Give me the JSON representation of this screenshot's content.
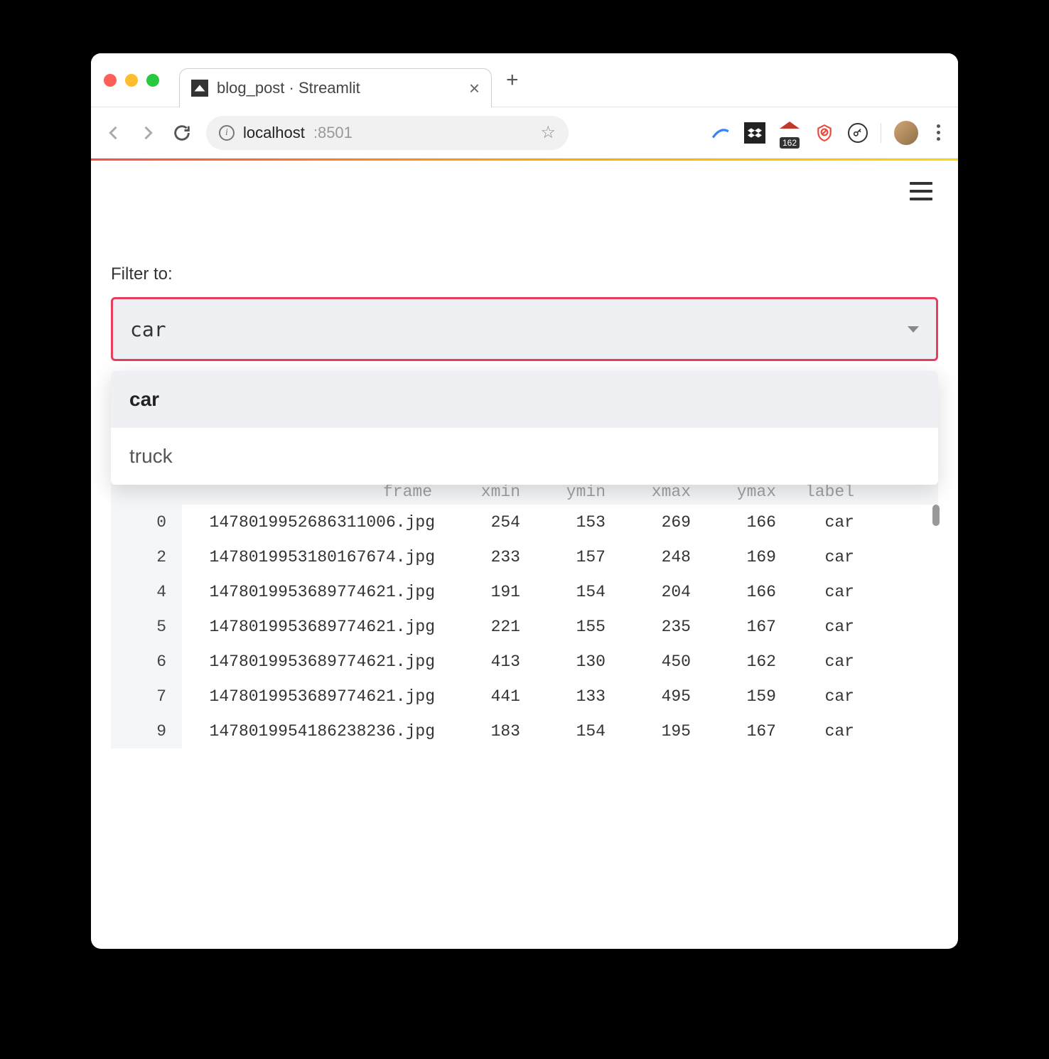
{
  "browser": {
    "tab_title": "blog_post · Streamlit",
    "address_host": "localhost",
    "address_port": ":8501",
    "lastpass_badge": "162"
  },
  "app": {
    "filter_label": "Filter to:",
    "select_value": "car",
    "dropdown_options": [
      {
        "label": "car",
        "selected": true
      },
      {
        "label": "truck",
        "selected": false
      }
    ],
    "columns": [
      "",
      "frame",
      "xmin",
      "ymin",
      "xmax",
      "ymax",
      "label"
    ],
    "rows": [
      {
        "idx": "0",
        "frame": "1478019952686311006.jpg",
        "xmin": "254",
        "ymin": "153",
        "xmax": "269",
        "ymax": "166",
        "label": "car"
      },
      {
        "idx": "2",
        "frame": "1478019953180167674.jpg",
        "xmin": "233",
        "ymin": "157",
        "xmax": "248",
        "ymax": "169",
        "label": "car"
      },
      {
        "idx": "4",
        "frame": "1478019953689774621.jpg",
        "xmin": "191",
        "ymin": "154",
        "xmax": "204",
        "ymax": "166",
        "label": "car"
      },
      {
        "idx": "5",
        "frame": "1478019953689774621.jpg",
        "xmin": "221",
        "ymin": "155",
        "xmax": "235",
        "ymax": "167",
        "label": "car"
      },
      {
        "idx": "6",
        "frame": "1478019953689774621.jpg",
        "xmin": "413",
        "ymin": "130",
        "xmax": "450",
        "ymax": "162",
        "label": "car"
      },
      {
        "idx": "7",
        "frame": "1478019953689774621.jpg",
        "xmin": "441",
        "ymin": "133",
        "xmax": "495",
        "ymax": "159",
        "label": "car"
      },
      {
        "idx": "9",
        "frame": "1478019954186238236.jpg",
        "xmin": "183",
        "ymin": "154",
        "xmax": "195",
        "ymax": "167",
        "label": "car"
      }
    ]
  }
}
